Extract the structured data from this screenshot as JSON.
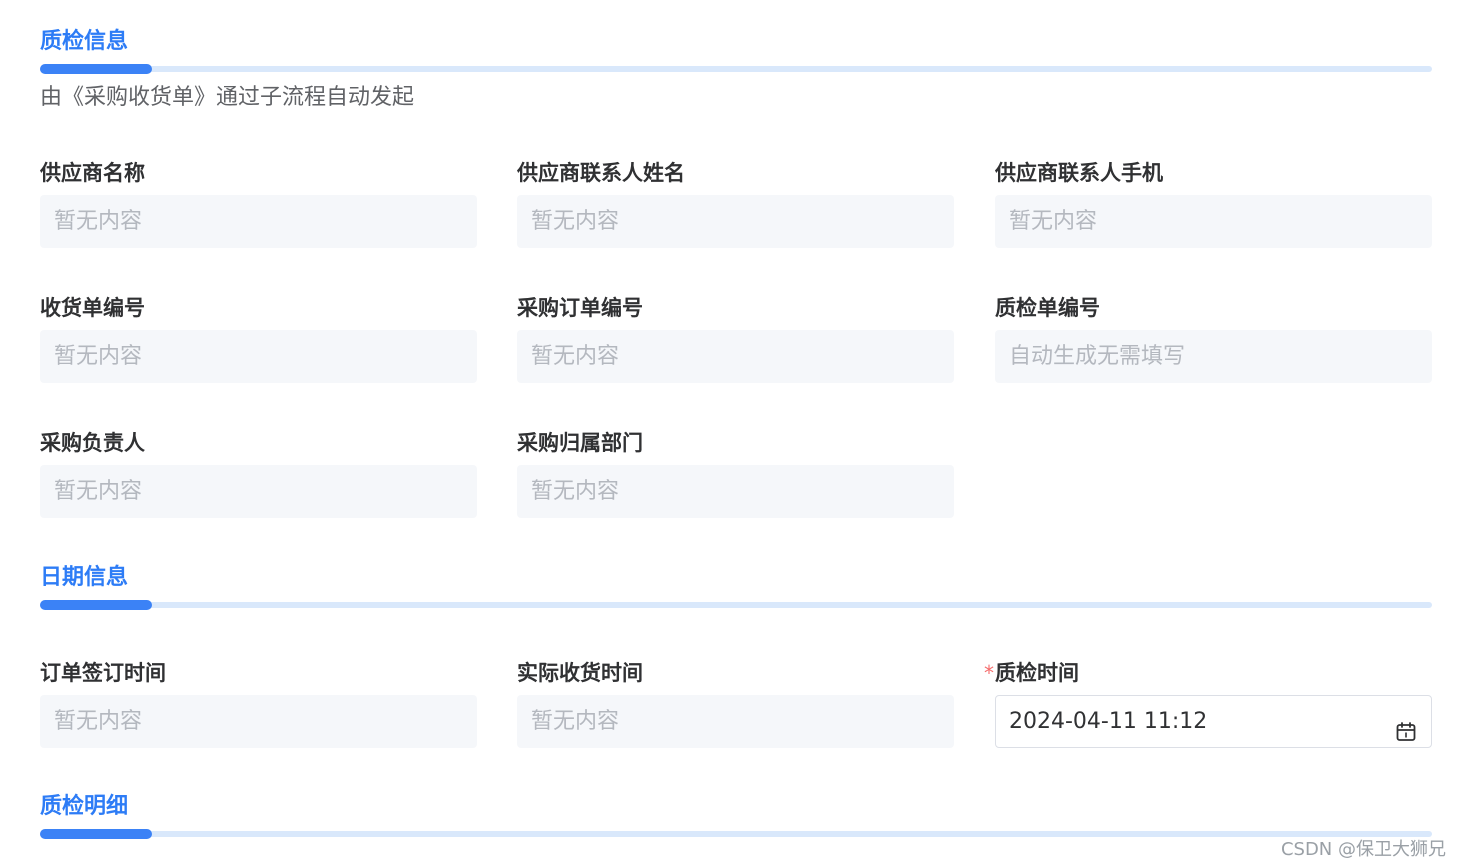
{
  "sections": {
    "qc_info": {
      "title": "质检信息",
      "description": "由《采购收货单》通过子流程自动发起"
    },
    "date_info": {
      "title": "日期信息"
    },
    "qc_detail": {
      "title": "质检明细"
    }
  },
  "fields": {
    "supplier_name": {
      "label": "供应商名称",
      "value": "暂无内容"
    },
    "supplier_contact_name": {
      "label": "供应商联系人姓名",
      "value": "暂无内容"
    },
    "supplier_contact_phone": {
      "label": "供应商联系人手机",
      "value": "暂无内容"
    },
    "receipt_no": {
      "label": "收货单编号",
      "value": "暂无内容"
    },
    "purchase_order_no": {
      "label": "采购订单编号",
      "value": "暂无内容"
    },
    "qc_no": {
      "label": "质检单编号",
      "value": "自动生成无需填写"
    },
    "purchaser": {
      "label": "采购负责人",
      "value": "暂无内容"
    },
    "purchase_dept": {
      "label": "采购归属部门",
      "value": "暂无内容"
    },
    "order_sign_time": {
      "label": "订单签订时间",
      "value": "暂无内容"
    },
    "actual_receipt_time": {
      "label": "实际收货时间",
      "value": "暂无内容"
    },
    "qc_time": {
      "label": "质检时间",
      "required_mark": "*",
      "value": "2024-04-11 11:12"
    }
  },
  "icons": {
    "calendar": "calendar-icon"
  },
  "colors": {
    "accent": "#3b82f6",
    "section_title": "#2d7cf6",
    "section_line": "#d9e8fb",
    "readonly_bg": "#f5f7fa",
    "placeholder_text": "#b4b8bf",
    "required": "#f56c6c"
  },
  "watermark": "CSDN @保卫大狮兄"
}
